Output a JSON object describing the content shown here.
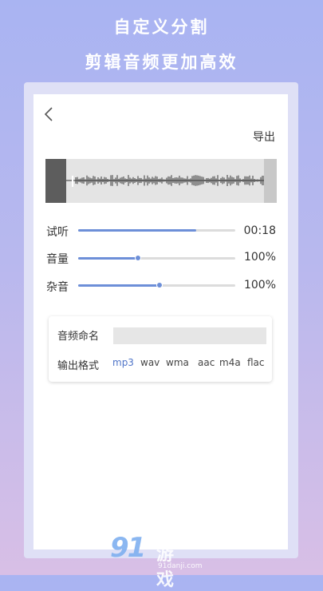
{
  "promo": {
    "line1": "自定义分割",
    "line2": "剪辑音频更加高效"
  },
  "header": {
    "back_icon": "chevron-left-icon",
    "export_label": "导出"
  },
  "controls": [
    {
      "label": "试听",
      "value": "00:18",
      "level": 0.75
    },
    {
      "label": "音量",
      "value": "100%",
      "level": 0.38
    },
    {
      "label": "杂音",
      "value": "100%",
      "level": 0.52
    }
  ],
  "form": {
    "name_label": "音频命名",
    "name_value": "",
    "format_label": "输出格式",
    "formats": [
      "mp3",
      "wav",
      "wma",
      "aac",
      "m4a",
      "flac"
    ],
    "selected_format": "mp3"
  },
  "watermark": {
    "logo": "91",
    "text": "游戏",
    "url": "91danji.com"
  },
  "colors": {
    "accent": "#6d8fd8",
    "active_format": "#4f74c8",
    "background_top": "#a9b4f2",
    "background_bottom": "#d8bfe6"
  }
}
